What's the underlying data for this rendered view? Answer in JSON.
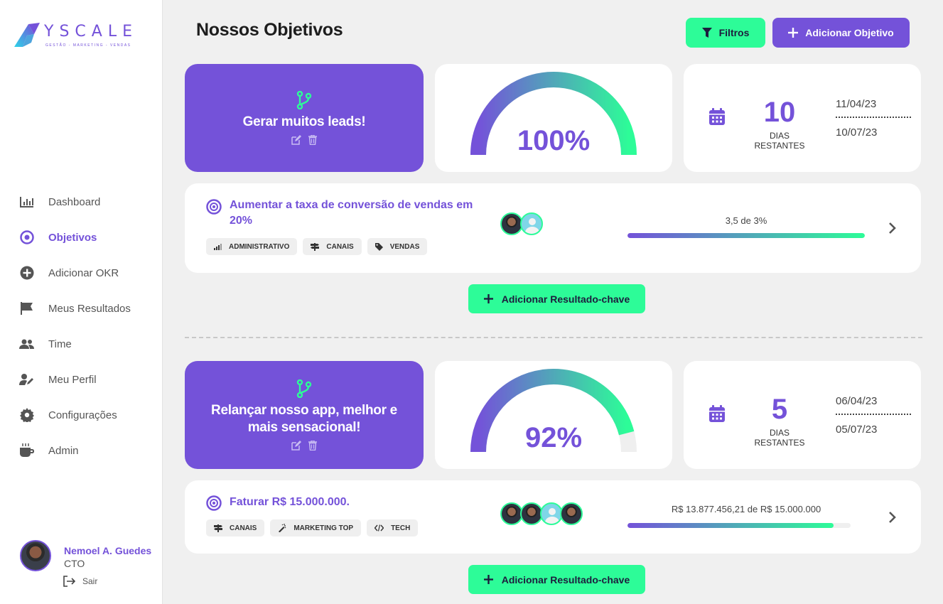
{
  "app": {
    "logo_word": "YSCALE",
    "logo_sub": "GESTÃO - MARKETING - VENDAS",
    "brand_color": "#7452d9",
    "accent_color": "#2dfc98"
  },
  "sidebar": {
    "items": [
      {
        "label": "Dashboard",
        "icon": "bar-chart-icon",
        "active": false
      },
      {
        "label": "Objetivos",
        "icon": "target-icon",
        "active": true
      },
      {
        "label": "Adicionar OKR",
        "icon": "plus-circle-icon",
        "active": false
      },
      {
        "label": "Meus Resultados",
        "icon": "flag-icon",
        "active": false
      },
      {
        "label": "Time",
        "icon": "users-icon",
        "active": false
      },
      {
        "label": "Meu Perfil",
        "icon": "user-edit-icon",
        "active": false
      },
      {
        "label": "Configurações",
        "icon": "gear-icon",
        "active": false
      },
      {
        "label": "Admin",
        "icon": "coffee-icon",
        "active": false
      }
    ],
    "user": {
      "name": "Nemoel A. Guedes",
      "role": "CTO",
      "logout": "Sair"
    }
  },
  "header": {
    "title": "Nossos Objetivos",
    "filter_label": "Filtros",
    "add_objective_label": "Adicionar Objetivo"
  },
  "objectives": [
    {
      "title": "Gerar muitos leads!",
      "progress_percent": 100,
      "progress_label": "100%",
      "days_remaining": "10",
      "days_label": "DIAS RESTANTES",
      "start_date": "11/04/23",
      "end_date": "10/07/23",
      "key_results": [
        {
          "title": "Aumentar a taxa de conversão de vendas em 20%",
          "tags": [
            {
              "label": "ADMINISTRATIVO",
              "icon": "signal-icon"
            },
            {
              "label": "CANAIS",
              "icon": "signpost-icon"
            },
            {
              "label": "VENDAS",
              "icon": "tag-icon"
            }
          ],
          "members": [
            "photo",
            "placeholder"
          ],
          "progress_text": "3,5 de 3%",
          "progress_fraction": 1.0
        }
      ],
      "add_kr_label": "Adicionar Resultado-chave"
    },
    {
      "title": "Relançar nosso app, melhor e mais sensacional!",
      "progress_percent": 92,
      "progress_label": "92%",
      "days_remaining": "5",
      "days_label": "DIAS RESTANTES",
      "start_date": "06/04/23",
      "end_date": "05/07/23",
      "key_results": [
        {
          "title": "Faturar R$ 15.000.000.",
          "tags": [
            {
              "label": "CANAIS",
              "icon": "signpost-icon"
            },
            {
              "label": "MARKETING TOP",
              "icon": "magic-wand-icon"
            },
            {
              "label": "TECH",
              "icon": "code-icon"
            }
          ],
          "members": [
            "photo",
            "photo",
            "placeholder",
            "photo"
          ],
          "progress_text": "R$ 13.877.456,21 de R$ 15.000.000",
          "progress_fraction": 0.925
        }
      ],
      "add_kr_label": "Adicionar Resultado-chave"
    }
  ]
}
